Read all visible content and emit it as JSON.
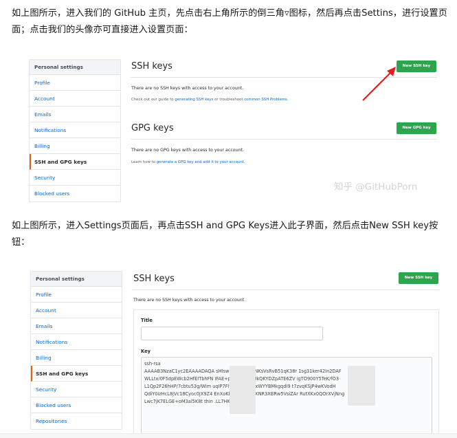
{
  "article": {
    "para1": "如上图所示，进入我们的 GitHub 主页，先点击右上角所示的倒三角▿图标，然后再点击Settins，进行设置页面；点击我们的头像亦可直接进入设置页面：",
    "para2": "如上图所示，进入Settings页面后，再点击SSH and GPG Keys进入此子界面，然后点击New SSH key按钮："
  },
  "screenshot1": {
    "menu_header": "Personal settings",
    "menu_items": [
      "Profile",
      "Account",
      "Emails",
      "Notifications",
      "Billing",
      "SSH and GPG keys",
      "Security",
      "Blocked users"
    ],
    "ssh_title": "SSH keys",
    "new_ssh_label": "New SSH key",
    "ssh_empty": "There are no SSH keys with access to your account.",
    "ssh_guide_pre": "Check out our guide to ",
    "ssh_guide_link1": "generating SSH keys",
    "ssh_guide_mid": " or troubleshoot ",
    "ssh_guide_link2": "common SSH Problems",
    "ssh_guide_end": ".",
    "gpg_title": "GPG keys",
    "new_gpg_label": "New GPG key",
    "gpg_empty": "There are no GPG keys with access to your account.",
    "gpg_learn_pre": "Learn how to ",
    "gpg_learn_link": "generate a GPG key and add it to your account",
    "gpg_learn_end": ".",
    "watermark": "知乎 @GitHubPorn"
  },
  "screenshot2": {
    "menu_header": "Personal settings",
    "menu_items": [
      "Profile",
      "Account",
      "Emails",
      "Notifications",
      "Billing",
      "SSH and GPG keys",
      "Security",
      "Blocked users",
      "Repositories"
    ],
    "ssh_title": "SSH keys",
    "new_ssh_label": "New SSH key",
    "ssh_empty": "There are no SSH keys with access to your account.",
    "title_label": "Title",
    "key_label": "Key",
    "key_lines": [
      "ssh-rsa",
      "AAAAB3NzaC1yc2EAAAADAQA                sHIswIGr6JyRK40NKsVsRvB51qK38r              1sg31ker42In2DAF",
      "WLLtx/0F5dpEWcb2HfEITbhFN                IFAE+pV4BI9vGbUkQKYDZpATE6ZV                igTO900Y5TeK/fO3",
      "L1Qp2F26hHP/7cbtu53g/Wim                uqIP7FlyAg5IksYgyxWYYBMkgqdI9              t7zvqKSJP4wKVodH",
      "QdiY0izHcL8jVc18Cyoc0JX9Z4              EnXoKbtXgzthREoXNR3XBRw5VsiZAr               RutXKx0QOrXVjNng",
      "Lwc7jK7ELGE+oM3al5K8t thin              .LL7HK8C"
    ]
  },
  "colors": {
    "link": "#0366d6",
    "button_green": "#2ea44f",
    "arrow_red": "#e02020",
    "active_marker": "#e36209"
  }
}
